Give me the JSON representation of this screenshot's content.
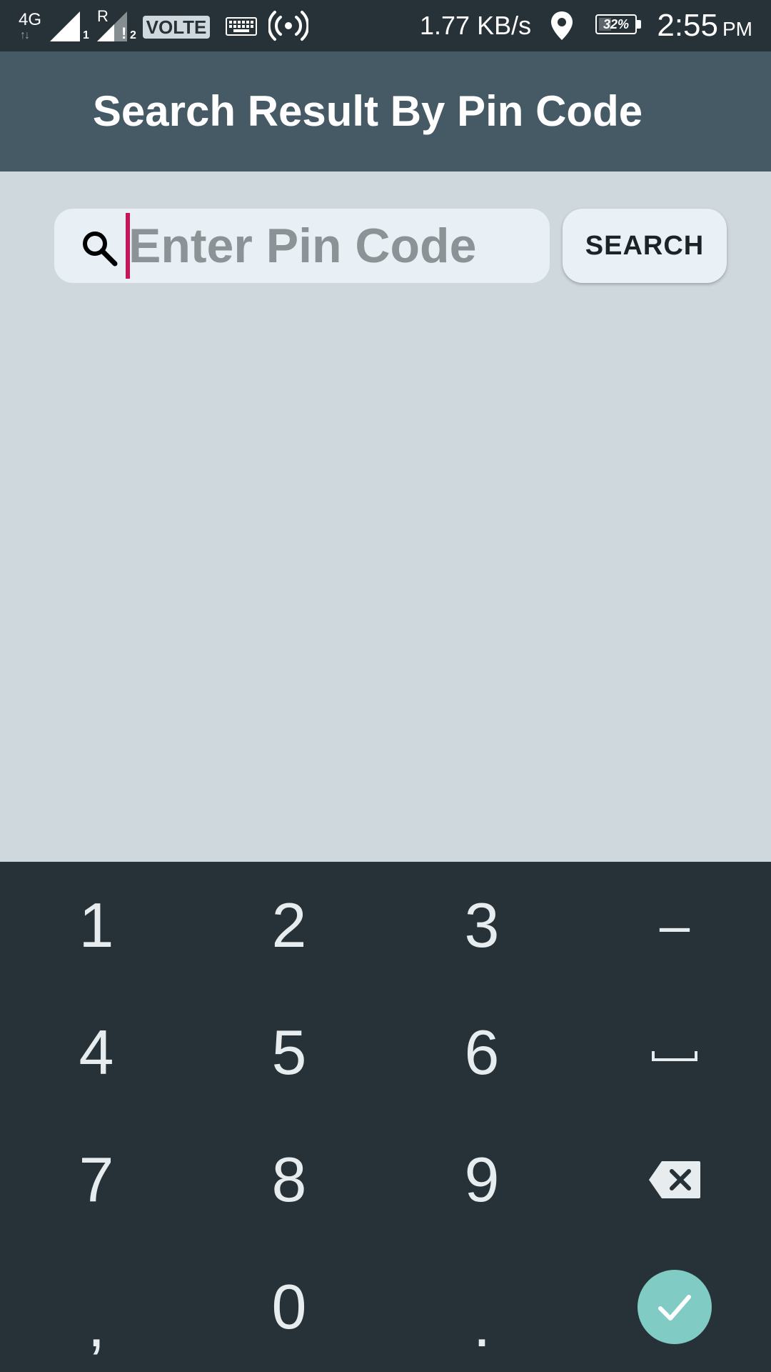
{
  "status_bar": {
    "network_type": "4G",
    "sim1_index": "1",
    "sim2_roaming": "R",
    "sim2_index": "2",
    "sim2_alert": "!",
    "volte": "VOLTE",
    "speed": "1.77 KB/s",
    "battery": "32%",
    "battery_level": 0.32,
    "time": "2:55",
    "ampm": "PM"
  },
  "app_bar": {
    "title": "Search Result By Pin Code"
  },
  "search": {
    "placeholder": "Enter Pin Code",
    "value": "",
    "button_label": "SEARCH"
  },
  "keyboard": {
    "keys": [
      "1",
      "2",
      "3",
      "–",
      "4",
      "5",
      "6",
      "space",
      "7",
      "8",
      "9",
      "backspace",
      ",",
      "0",
      ".",
      "done"
    ],
    "rows": [
      [
        "1",
        "2",
        "3",
        "–"
      ],
      [
        "4",
        "5",
        "6"
      ],
      [
        "7",
        "8",
        "9"
      ],
      [
        ",",
        "0",
        "."
      ]
    ]
  },
  "colors": {
    "status_bar": "#263238",
    "app_bar": "#455a64",
    "background": "#cfd8dc",
    "keyboard": "#263238",
    "cursor": "#c2185b",
    "done_button": "#80cbc4"
  }
}
